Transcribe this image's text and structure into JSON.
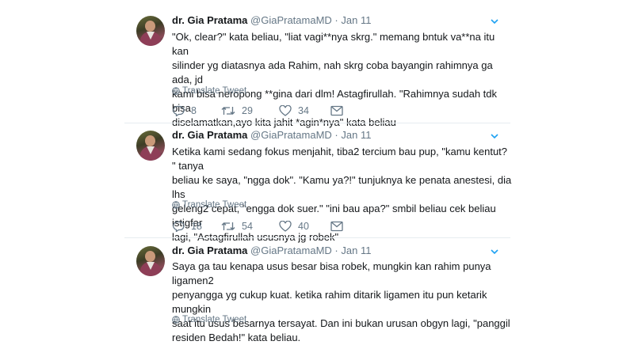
{
  "tweets": [
    {
      "name": "dr. Gia Pratama",
      "handle": "@GiaPratamaMD",
      "dot": "·",
      "date": "Jan 11",
      "lines": [
        "\"Ok, clear?\" kata beliau, \"liat vagi**nya skrg.\" memang bntuk va**na itu kan",
        "silinder yg diatasnya ada Rahim, nah skrg coba bayangin rahimnya ga ada, jd",
        "kami bisa neropong **gina dari dlm!  Astagfirullah. \"Rahimnya sudah tdk bisa",
        "diselamatkan,ayo kita jahit *agin*nya\" kata beliau"
      ],
      "translate": "Translate Tweet",
      "replies": "8",
      "retweets": "29",
      "likes": "34"
    },
    {
      "name": "dr. Gia Pratama",
      "handle": "@GiaPratamaMD",
      "dot": "·",
      "date": "Jan 11",
      "lines": [
        "Ketika kami sedang fokus menjahit, tiba2 tercium bau pup, \"kamu kentut? \" tanya",
        "beliau ke saya, \"ngga dok\". \"Kamu ya?!\" tunjuknya ke penata anestesi, dia lhs",
        "geleng2 cepat, \"engga dok suer.\" \"ini bau apa?\" smbil beliau cek beliau istigfar",
        "lagi, \"Astagfirullah ususnya jg robek\""
      ],
      "translate": "Translate Tweet",
      "replies": "18",
      "retweets": "54",
      "likes": "40"
    },
    {
      "name": "dr. Gia Pratama",
      "handle": "@GiaPratamaMD",
      "dot": "·",
      "date": "Jan 11",
      "lines": [
        "Saya ga tau kenapa usus besar bisa robek, mungkin kan rahim punya ligamen2",
        "penyangga yg cukup kuat.  ketika rahim ditarik ligamen itu pun ketarik mungkin",
        "saat itu usus besarnya tersayat. Dan ini bukan urusan obgyn lagi, \"panggil",
        "residen Bedah!\" kata beliau."
      ],
      "translate": "Translate Tweet"
    }
  ],
  "icons": {
    "reply": "reply-icon",
    "retweet": "retweet-icon",
    "like": "heart-icon",
    "dm": "message-icon",
    "more": "chevron-down-icon",
    "translate": "globe-icon"
  },
  "colors": {
    "text": "#14171a",
    "secondary": "#657786",
    "chevron": "#1da1f2",
    "divider": "#e6ecf0"
  }
}
